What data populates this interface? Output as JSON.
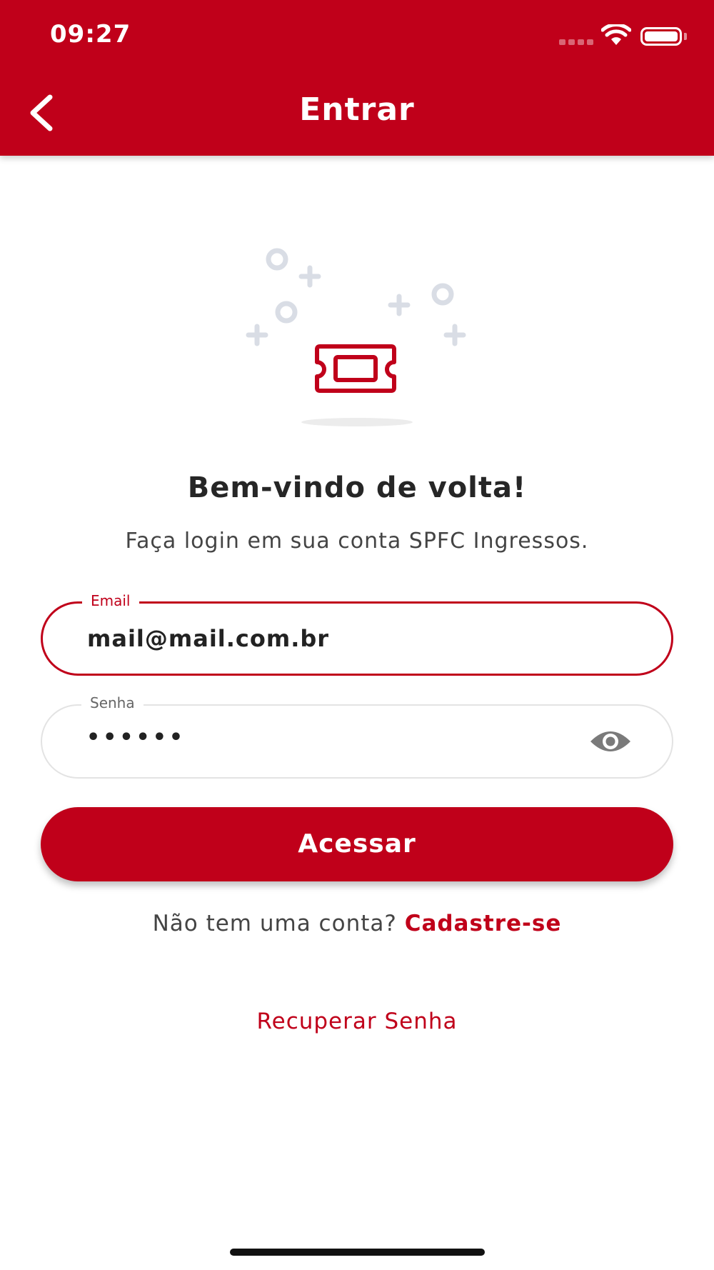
{
  "status_bar": {
    "time": "09:27"
  },
  "header": {
    "title": "Entrar",
    "back_icon": "chevron-left-icon",
    "background_color": "#C0001A"
  },
  "illustration": {
    "icon": "ticket-icon",
    "accent_color": "#C0001A"
  },
  "welcome": {
    "title": "Bem-vindo de volta!",
    "subtitle": "Faça login em sua conta SPFC Ingressos."
  },
  "form": {
    "email": {
      "label": "Email",
      "value": "mail@mail.com.br"
    },
    "password": {
      "label": "Senha",
      "value": "••••••",
      "toggle_icon": "eye-icon"
    },
    "submit_label": "Acessar"
  },
  "signup": {
    "prompt": "Não tem uma conta?",
    "link_label": "Cadastre-se"
  },
  "recover": {
    "link_label": "Recuperar Senha"
  }
}
